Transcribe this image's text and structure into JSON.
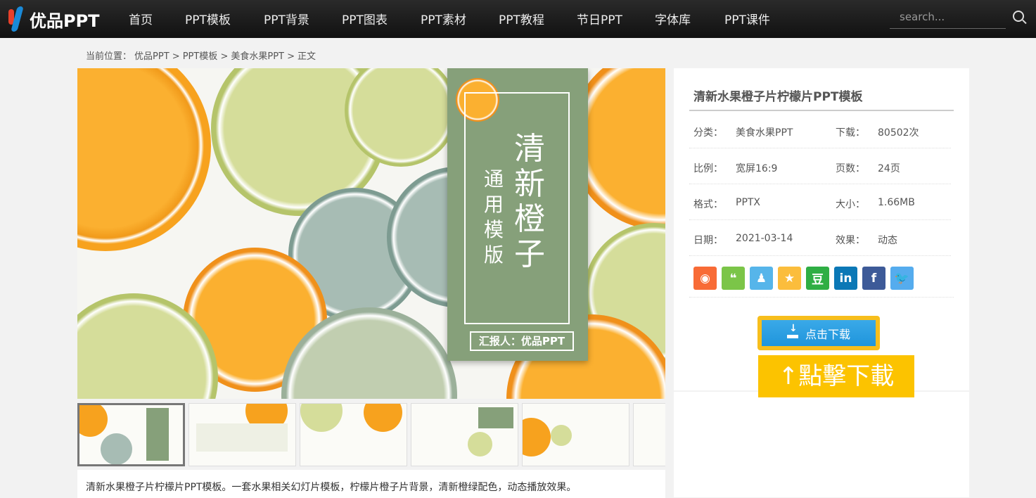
{
  "nav": {
    "logo": "优品PPT",
    "items": [
      "首页",
      "PPT模板",
      "PPT背景",
      "PPT图表",
      "PPT素材",
      "PPT教程",
      "节日PPT",
      "字体库",
      "PPT课件"
    ],
    "search_placeholder": "search..."
  },
  "breadcrumb": {
    "prefix": "当前位置：",
    "items": [
      "优品PPT",
      "PPT模板",
      "美食水果PPT",
      "正文"
    ],
    "sep": ">"
  },
  "slide": {
    "title": "清新橙子",
    "subtitle": "通用模版",
    "reporter": "汇报人：优品PPT"
  },
  "panel": {
    "title": "清新水果橙子片柠檬片PPT模板",
    "rows": [
      {
        "l1": "分类：",
        "v1": "美食水果PPT",
        "l2": "下载：",
        "v2": "80502次"
      },
      {
        "l1": "比例：",
        "v1": "宽屏16:9",
        "l2": "页数：",
        "v2": "24页"
      },
      {
        "l1": "格式：",
        "v1": "PPTX",
        "l2": "大小：",
        "v2": "1.66MB"
      },
      {
        "l1": "日期：",
        "v1": "2021-03-14",
        "l2": "效果：",
        "v2": "动态"
      }
    ],
    "shares": [
      {
        "name": "weibo",
        "glyph": "◉",
        "color": "#f86b36"
      },
      {
        "name": "wechat",
        "glyph": "❝",
        "color": "#7bc548"
      },
      {
        "name": "qq",
        "glyph": "♟",
        "color": "#56b5ea"
      },
      {
        "name": "qzone",
        "glyph": "★",
        "color": "#fbbd3c"
      },
      {
        "name": "douban",
        "glyph": "豆",
        "color": "#2fae44"
      },
      {
        "name": "linkedin",
        "glyph": "in",
        "color": "#0b78b6"
      },
      {
        "name": "facebook",
        "glyph": "f",
        "color": "#3d5a98"
      },
      {
        "name": "twitter",
        "glyph": "🐦",
        "color": "#55acee"
      }
    ],
    "download": "点击下载"
  },
  "note": "↑點擊下載",
  "description": "清新水果橙子片柠檬片PPT模板。一套水果相关幻灯片模板，柠檬片橙子片背景，清新橙绿配色，动态播放效果。"
}
